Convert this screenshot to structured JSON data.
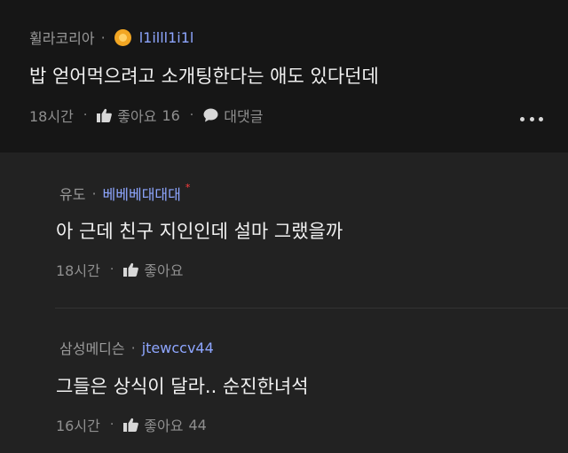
{
  "post": {
    "author": "휠라코리아",
    "nickname": "l1illl1i1l",
    "text": "밥 얻어먹으려고 소개팅한다는 애도 있다던데",
    "time": "18시간",
    "like_label": "좋아요",
    "like_count": "16",
    "reply_label": "대댓글"
  },
  "replies": [
    {
      "author": "유도",
      "nickname": "베베베대대대",
      "text": "아 근데 친구 지인인데 설마 그랬을까",
      "time": "18시간",
      "like_label": "좋아요",
      "like_count": ""
    },
    {
      "author": "삼성메디슨",
      "nickname": "jtewccv44",
      "text": "그들은 상식이 달라.. 순진한녀석",
      "time": "16시간",
      "like_label": "좋아요",
      "like_count": "44"
    }
  ],
  "separator": "·",
  "star": "*",
  "colors": {
    "nickname": "#8ea6ff",
    "badge": "#f2a623",
    "star": "#ff3d3d"
  }
}
